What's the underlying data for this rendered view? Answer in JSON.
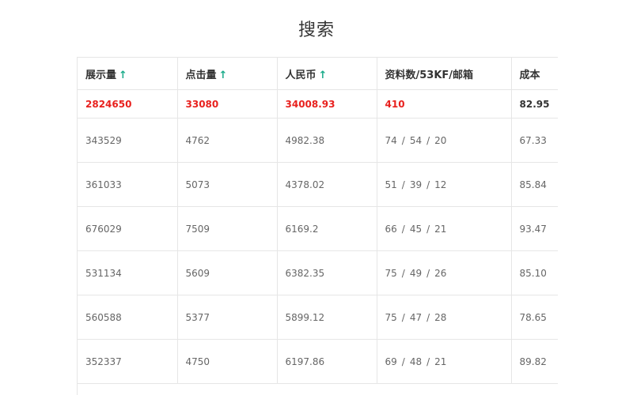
{
  "page": {
    "title": "搜索"
  },
  "table": {
    "headers": [
      {
        "label": "展示量",
        "sort": "↑"
      },
      {
        "label": "点击量",
        "sort": "↑"
      },
      {
        "label": "人民币",
        "sort": "↑"
      },
      {
        "label": "资料数/53KF/邮箱"
      },
      {
        "label": "成本"
      }
    ],
    "total": {
      "impressions": "2824650",
      "clicks": "33080",
      "rmb": "34008.93",
      "leads": "410",
      "cost": "82.95"
    },
    "rows": [
      {
        "impressions": "343529",
        "clicks": "4762",
        "rmb": "4982.38",
        "leads": [
          "74",
          "54",
          "20"
        ],
        "cost": "67.33"
      },
      {
        "impressions": "361033",
        "clicks": "5073",
        "rmb": "4378.02",
        "leads": [
          "51",
          "39",
          "12"
        ],
        "cost": "85.84"
      },
      {
        "impressions": "676029",
        "clicks": "7509",
        "rmb": "6169.2",
        "leads": [
          "66",
          "45",
          "21"
        ],
        "cost": "93.47"
      },
      {
        "impressions": "531134",
        "clicks": "5609",
        "rmb": "6382.35",
        "leads": [
          "75",
          "49",
          "26"
        ],
        "cost": "85.10"
      },
      {
        "impressions": "560588",
        "clicks": "5377",
        "rmb": "5899.12",
        "leads": [
          "75",
          "47",
          "28"
        ],
        "cost": "78.65"
      },
      {
        "impressions": "352337",
        "clicks": "4750",
        "rmb": "6197.86",
        "leads": [
          "69",
          "48",
          "21"
        ],
        "cost": "89.82"
      }
    ],
    "separator": "/"
  },
  "colors": {
    "total_text": "#e8211e",
    "sort_arrow": "#1aab8a",
    "grid": "#e6e6e6"
  }
}
